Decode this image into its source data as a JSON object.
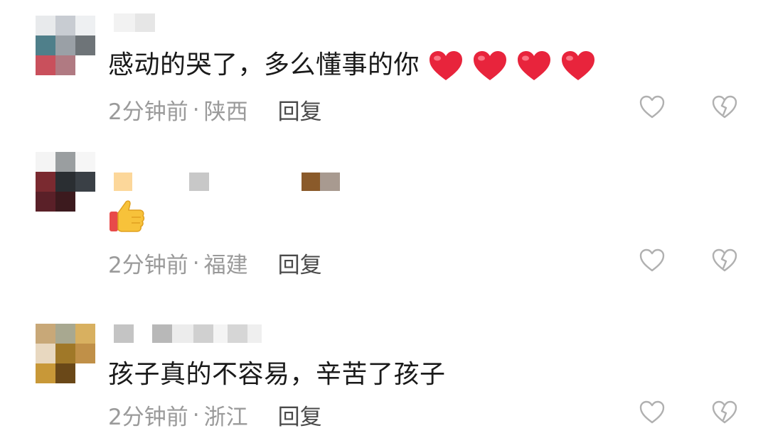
{
  "comments": [
    {
      "text": "感动的哭了，多么懂事的你",
      "emoji_count": 4,
      "time": "2分钟前",
      "sep": "·",
      "location": "陕西",
      "reply_label": "回复"
    },
    {
      "text": "",
      "emoji_count": 1,
      "time": "2分钟前",
      "sep": "·",
      "location": "福建",
      "reply_label": "回复"
    },
    {
      "text": "孩子真的不容易，辛苦了孩子",
      "emoji_count": 0,
      "time": "2分钟前",
      "sep": "·",
      "location": "浙江",
      "reply_label": "回复"
    }
  ],
  "colors": {
    "text": "#1a1a1a",
    "meta": "#9a9a9a",
    "reply": "#4a4a4a",
    "heart": "#e8243c",
    "icon_stroke": "#b0b0b0"
  },
  "icons": {
    "like": "heart-outline-icon",
    "dislike": "broken-heart-outline-icon",
    "heart_emoji": "red-heart-emoji",
    "thumbs_up_emoji": "thumbs-up-emoji"
  }
}
